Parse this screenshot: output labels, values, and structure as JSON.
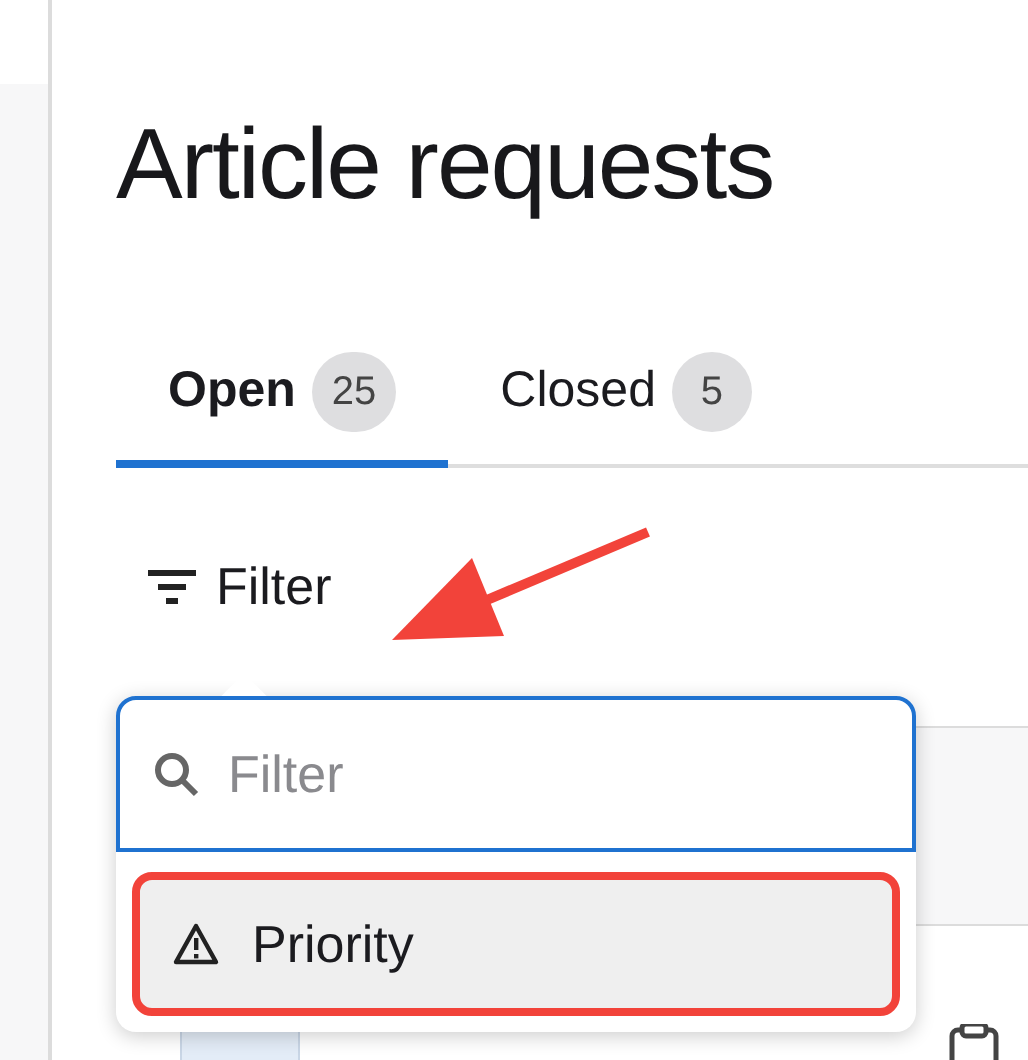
{
  "page": {
    "title": "Article requests"
  },
  "tabs": [
    {
      "label": "Open",
      "count": "25",
      "selected": true
    },
    {
      "label": "Closed",
      "count": "5",
      "selected": false
    }
  ],
  "filter_button": {
    "label": "Filter"
  },
  "filter_popover": {
    "search": {
      "placeholder": "Filter"
    },
    "options": [
      {
        "label": "Priority",
        "highlighted": true
      }
    ]
  }
}
